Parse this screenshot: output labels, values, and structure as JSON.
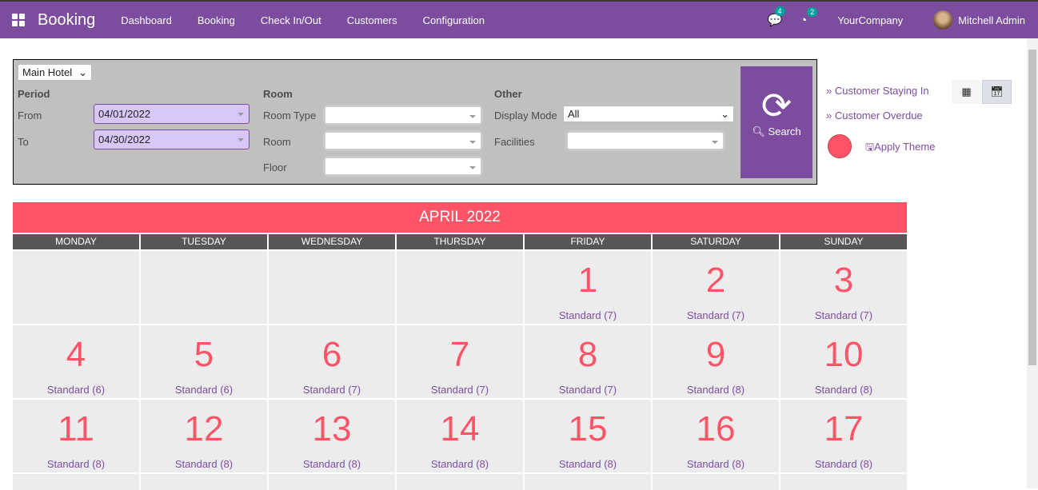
{
  "nav": {
    "brand": "Booking",
    "menu": [
      "Dashboard",
      "Booking",
      "Check In/Out",
      "Customers",
      "Configuration"
    ],
    "messages_count": "4",
    "activities_count": "2",
    "company": "YourCompany",
    "user": "Mitchell Admin"
  },
  "filters": {
    "hotel": "Main Hotel",
    "period_label": "Period",
    "from_label": "From",
    "from_value": "04/01/2022",
    "to_label": "To",
    "to_value": "04/30/2022",
    "room_label": "Room",
    "room_type_label": "Room Type",
    "room_field_label": "Room",
    "floor_label": "Floor",
    "other_label": "Other",
    "display_mode_label": "Display Mode",
    "display_mode_value": "All",
    "facilities_label": "Facilities",
    "search_label": "Search"
  },
  "side": {
    "staying": "» Customer Staying In",
    "overdue": "» Customer Overdue",
    "apply_theme": "Apply Theme",
    "theme_color": "#ff5468"
  },
  "calendar": {
    "month": "APRIL 2022",
    "weekdays": [
      "MONDAY",
      "TUESDAY",
      "WEDNESDAY",
      "THURSDAY",
      "FRIDAY",
      "SATURDAY",
      "SUNDAY"
    ],
    "weeks": [
      [
        null,
        null,
        null,
        null,
        {
          "day": "1",
          "info": "Standard (7)"
        },
        {
          "day": "2",
          "info": "Standard (7)"
        },
        {
          "day": "3",
          "info": "Standard (7)"
        }
      ],
      [
        {
          "day": "4",
          "info": "Standard (6)"
        },
        {
          "day": "5",
          "info": "Standard (6)"
        },
        {
          "day": "6",
          "info": "Standard (7)"
        },
        {
          "day": "7",
          "info": "Standard (7)"
        },
        {
          "day": "8",
          "info": "Standard (7)"
        },
        {
          "day": "9",
          "info": "Standard (8)"
        },
        {
          "day": "10",
          "info": "Standard (8)"
        }
      ],
      [
        {
          "day": "11",
          "info": "Standard (8)"
        },
        {
          "day": "12",
          "info": "Standard (8)"
        },
        {
          "day": "13",
          "info": "Standard (8)"
        },
        {
          "day": "14",
          "info": "Standard (8)"
        },
        {
          "day": "15",
          "info": "Standard (8)"
        },
        {
          "day": "16",
          "info": "Standard (8)"
        },
        {
          "day": "17",
          "info": "Standard (8)"
        }
      ],
      [
        null,
        null,
        null,
        null,
        null,
        null,
        null
      ]
    ]
  }
}
